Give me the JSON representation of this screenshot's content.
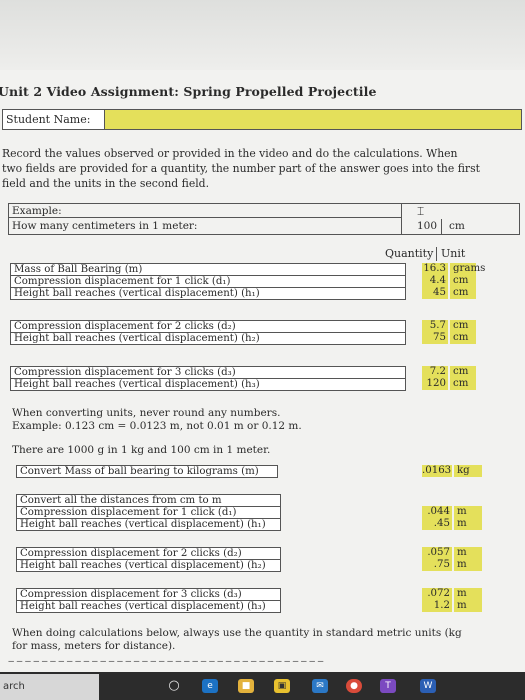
{
  "title": "Unit 2 Video Assignment: Spring Propelled Projectile",
  "student_name_label": "Student Name:",
  "instructions": [
    "Record the values observed or provided in the video and do the calculations.  When",
    "two fields are provided for a quantity, the number part of the answer goes into the first",
    "field and the units in the second field."
  ],
  "example": {
    "label": "Example:",
    "question": "How many centimeters in 1 meter:",
    "quantity": "100",
    "unit": "cm"
  },
  "headers": {
    "quantity": "Quantity",
    "unit": "Unit"
  },
  "measurements": [
    [
      {
        "label": "Mass of Ball Bearing (m)",
        "qty": "16.3",
        "unit": "grams"
      },
      {
        "label": "Compression displacement for 1 click (d₁)",
        "qty": "4.4",
        "unit": "cm"
      },
      {
        "label": "Height ball reaches (vertical displacement) (h₁)",
        "qty": "45",
        "unit": "cm"
      }
    ],
    [
      {
        "label": "Compression displacement for 2 clicks (d₂)",
        "qty": "5.7",
        "unit": "cm"
      },
      {
        "label": "Height ball reaches (vertical displacement) (h₂)",
        "qty": "75",
        "unit": "cm"
      }
    ],
    [
      {
        "label": "Compression displacement for 3 clicks (d₃)",
        "qty": "7.2",
        "unit": "cm"
      },
      {
        "label": "Height ball reaches (vertical displacement) (h₃)",
        "qty": "120",
        "unit": "cm"
      }
    ]
  ],
  "notes": {
    "line1": "When converting units, never round any numbers.",
    "line2": "Example: 0.123 cm = 0.0123 m, not 0.01 m or 0.12 m.",
    "line3": "There are 1000 g in 1 kg and 100 cm in 1 meter."
  },
  "convert_mass": {
    "label": "Convert Mass of ball bearing to kilograms (m)",
    "qty": ".0163",
    "unit": "kg"
  },
  "conversions": [
    [
      {
        "label": "Convert all the distances from cm to m",
        "qty": "",
        "unit": ""
      },
      {
        "label": "Compression displacement for 1 click (d₁)",
        "qty": ".044",
        "unit": "m"
      },
      {
        "label": "Height ball reaches (vertical displacement) (h₁)",
        "qty": ".45",
        "unit": "m"
      }
    ],
    [
      {
        "label": "Compression displacement for 2 clicks (d₂)",
        "qty": ".057",
        "unit": "m"
      },
      {
        "label": "Height ball reaches (vertical displacement) (h₂)",
        "qty": ".75",
        "unit": "m"
      }
    ],
    [
      {
        "label": "Compression displacement for 3 clicks (d₃)",
        "qty": ".072",
        "unit": "m"
      },
      {
        "label": "Height ball reaches (vertical displacement) (h₃)",
        "qty": "1.2",
        "unit": "m"
      }
    ]
  ],
  "bottom_note": {
    "line1": "When doing calculations below, always use the quantity in standard metric units (kg",
    "line2": "for mass, meters for distance)."
  },
  "taskbar": {
    "search_text": "arch"
  },
  "colors": {
    "field": "#e4e05b",
    "taskbar": "#2c2c2c"
  }
}
